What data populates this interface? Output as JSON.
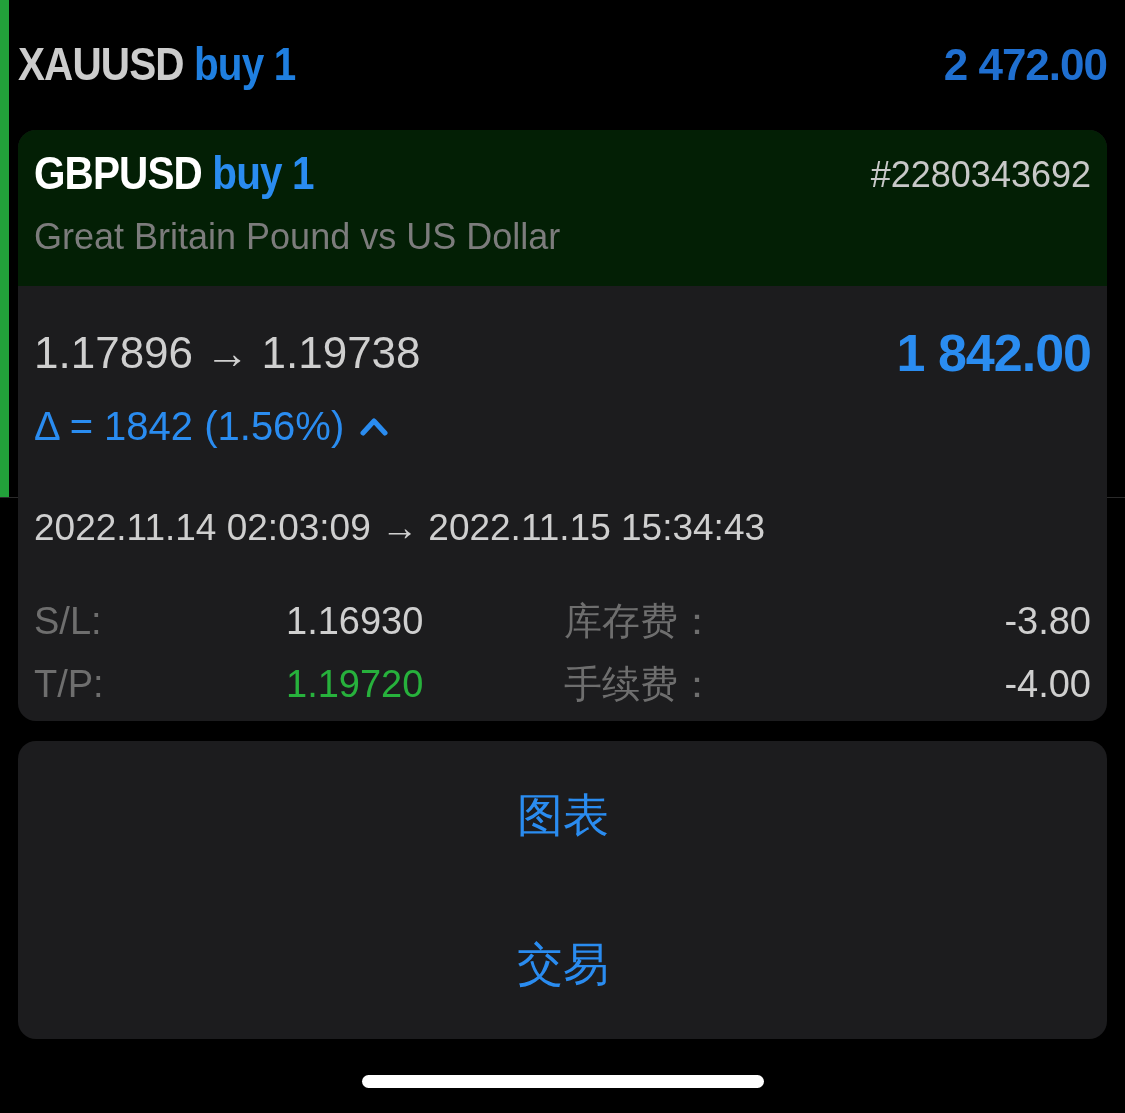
{
  "background_rows": [
    {
      "symbol": "XAUUSD",
      "side": "buy 1",
      "profit": "2 472.00",
      "color": "#22a13a"
    },
    {
      "color": "#22a13a"
    }
  ],
  "position": {
    "symbol": "GBPUSD",
    "side": "buy 1",
    "ticket": "#2280343692",
    "description": "Great Britain Pound vs US Dollar",
    "prices": "1.17896 → 1.19738",
    "profit": "1 842.00",
    "delta": "Δ = 1842 (1.56%)",
    "expanded": true,
    "times": "2022.11.14 02:03:09 → 2022.11.15 15:34:43",
    "details": [
      {
        "label": "S/L:",
        "value": "1.16930",
        "kind": "plain"
      },
      {
        "label": "库存费：",
        "value": "-3.80",
        "kind": "plain"
      },
      {
        "label": "T/P:",
        "value": "1.19720",
        "kind": "take_profit"
      },
      {
        "label": "手续费：",
        "value": "-4.00",
        "kind": "plain"
      }
    ]
  },
  "actions": [
    "图表",
    "交易"
  ]
}
